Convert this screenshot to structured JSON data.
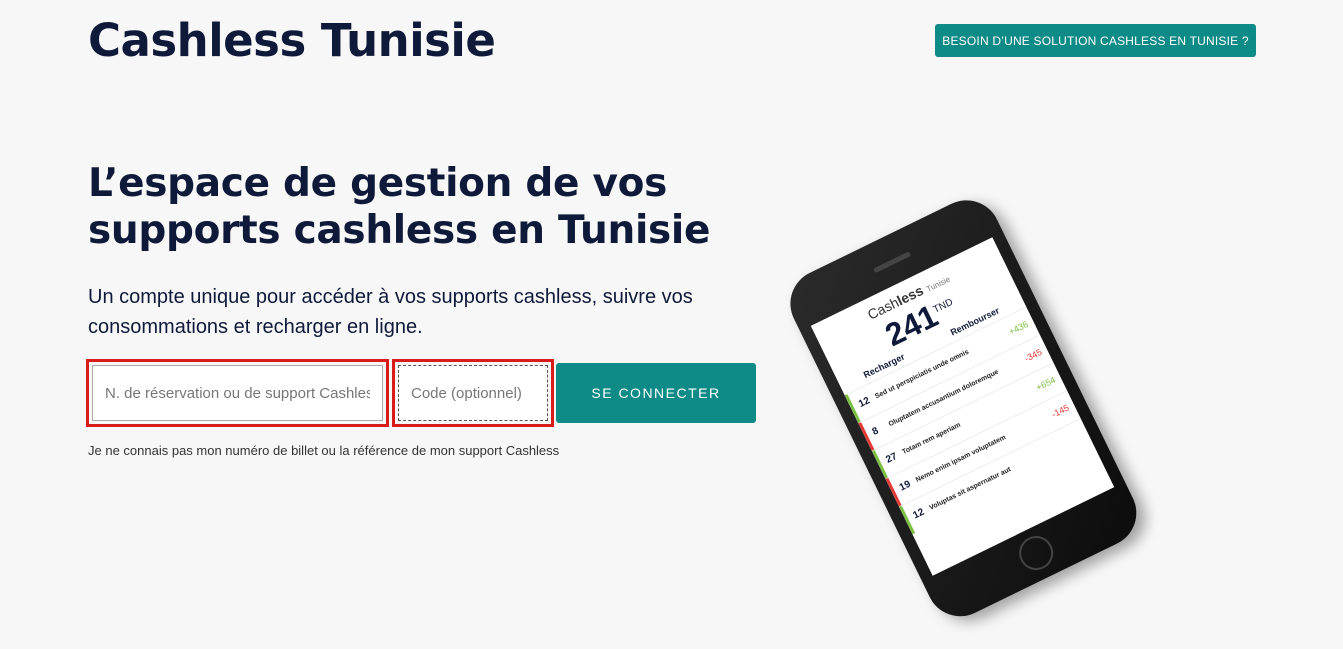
{
  "header": {
    "logo": "Cashless Tunisie",
    "cta_label": "BESOIN D’UNE SOLUTION CASHLESS EN TUNISIE ?"
  },
  "hero": {
    "title": "L’espace de gestion de vos supports cashless en Tunisie",
    "subtitle": "Un compte unique pour accéder à vos supports cashless, suivre vos consommations et recharger en ligne."
  },
  "form": {
    "reservation_placeholder": "N. de réservation ou de support Cashless",
    "code_placeholder": "Code (optionnel)",
    "submit_label": "SE CONNECTER",
    "help_link": "Je ne connais pas mon numéro de billet ou la référence de mon support Cashless"
  },
  "phone": {
    "brand_a": "Cash",
    "brand_b": "less",
    "brand_c": "Tunisie",
    "amount": "241",
    "currency": "TND",
    "recharge": "Recharger",
    "refund": "Rembourser",
    "rows": [
      {
        "day": "12",
        "text": "Sed ut perspiciatis unde omnis",
        "value": "+436"
      },
      {
        "day": "8",
        "text": "Oluptatem accusantium doloremque",
        "value": "-345"
      },
      {
        "day": "27",
        "text": "Totam rem aperiam",
        "value": "+654"
      },
      {
        "day": "19",
        "text": "Nemo enim ipsam voluptatem",
        "value": "-145"
      },
      {
        "day": "12",
        "text": "Voluptas sit aspernatur aut",
        "value": ""
      }
    ]
  },
  "colors": {
    "accent": "#0e8a87",
    "text": "#0f1a3a",
    "highlight": "#d81b1b"
  }
}
